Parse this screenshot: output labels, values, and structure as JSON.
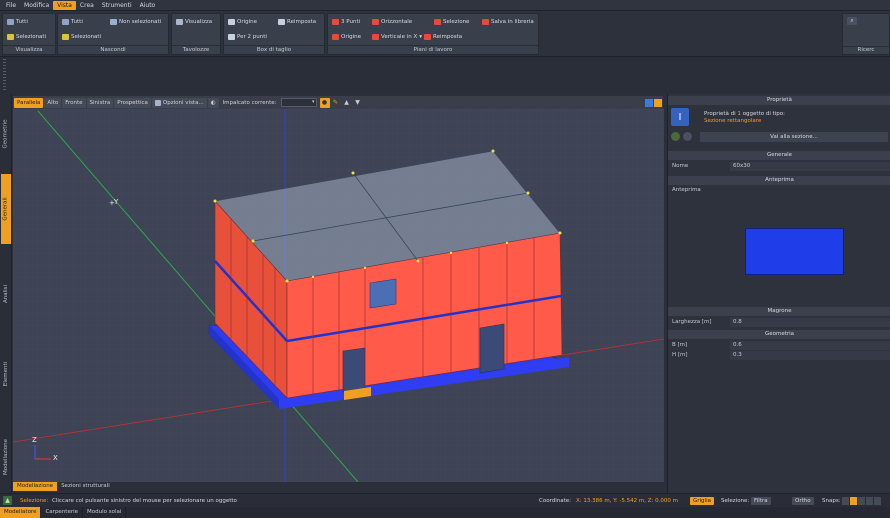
{
  "menubar": {
    "items": [
      "File",
      "Modifica",
      "Vista",
      "Crea",
      "Strumenti",
      "Aiuto"
    ],
    "active": "Vista"
  },
  "ribbon": {
    "visualizza": {
      "title": "Visualizza",
      "tutti": "Tutti",
      "selezionati": "Selezionati"
    },
    "nascondi": {
      "title": "Nascondi",
      "tutti": "Tutti",
      "non_selezionati": "Non selezionati",
      "selezionati": "Selezionati"
    },
    "tavolozze": {
      "title": "Tavolozze",
      "visualizza": "Visualizza"
    },
    "box_taglio": {
      "title": "Box di taglio",
      "origine": "Origine",
      "reimposta": "Reimposta",
      "per_2_punti": "Per 2 punti"
    },
    "piani_lavoro": {
      "title": "Piani di lavoro",
      "tre_punti": "3 Punti",
      "orizzontale": "Orizzontale",
      "selezione": "Selezione",
      "salva_libreria": "Salva in libreria",
      "origine": "Origine",
      "verticale_x": "Verticale in X",
      "reimposta": "Reimposta"
    },
    "ricerca_label": "Ricerc"
  },
  "left_tabs": [
    "Geometrie",
    "Generali",
    "Analisi",
    "Elementi",
    "Modellazione"
  ],
  "left_tabs_active": "Generali",
  "viewport_toolbar": {
    "views": [
      "Parallela",
      "Alto",
      "Fronte",
      "Sinistra",
      "Prospettica"
    ],
    "active_view": "Parallela",
    "options": "Opzioni vista...",
    "impalcato_label": "Impalcato corrente:"
  },
  "viewport": {
    "axis_y": "Y",
    "axis_z": "Z",
    "axis_x": "X"
  },
  "viewport_tabs": [
    "Modellazione",
    "Sezioni strutturali"
  ],
  "viewport_tabs_active": "Modellazione",
  "properties": {
    "title": "Proprietà",
    "summary_prefix": "Proprietà di",
    "summary_count": "1",
    "summary_suffix": "oggetto di tipo:",
    "object_type": "Sezione rettangolare",
    "goto_button": "Vai alla sezione...",
    "generale_header": "Generale",
    "nome_label": "Nome",
    "nome_value": "60x30",
    "anteprima_header": "Anteprima",
    "anteprima_label": "Anteprima",
    "magrone_header": "Magrone",
    "larghezza_label": "Larghezza [m]",
    "larghezza_value": "0.8",
    "geometria_header": "Geometria",
    "b_label": "B [m]",
    "b_value": "0.6",
    "h_label": "H [m]",
    "h_value": "0.3",
    "preview_color": "#1f3de8"
  },
  "statusbar": {
    "sel_label": "Selezione:",
    "sel_text": "Cliccare col pulsante sinistro del mouse per selezionare un oggetto",
    "coord_label": "Coordinate:",
    "coord_value": "X: 13.386 m, Y: -5.542 m, Z: 0.000 m",
    "griglia": "Griglia",
    "selezione_label": "Selezione:",
    "filtra": "Filtra",
    "ortho": "Ortho",
    "snaps_label": "Snaps:"
  },
  "bottom_tabs": [
    "Modellatore",
    "Carpenterie",
    "Modulo solai"
  ],
  "bottom_tabs_active": "Modellatore",
  "colors": {
    "accent": "#f0a020",
    "wall": "#ff5a4a",
    "foundation": "#2d3cf0",
    "background": "#3e4455"
  }
}
